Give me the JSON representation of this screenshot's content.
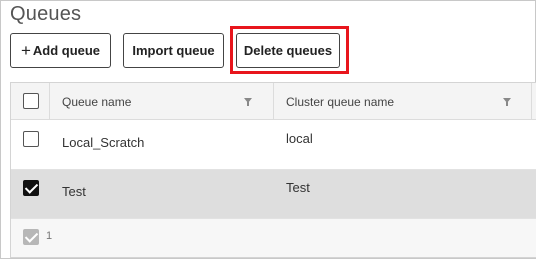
{
  "page": {
    "title": "Queues"
  },
  "toolbar": {
    "add_label": "Add queue",
    "add_icon": "plus-icon",
    "import_label": "Import queue",
    "delete_label": "Delete queues",
    "highlight_color": "#e8151c"
  },
  "grid": {
    "columns": [
      {
        "label": "Queue name",
        "filter_icon": "filter-icon"
      },
      {
        "label": "Cluster queue name",
        "filter_icon": "filter-icon"
      }
    ],
    "rows": [
      {
        "queue_name": "Local_Scratch",
        "cluster_queue_name": "local",
        "selected": false
      },
      {
        "queue_name": "Test",
        "cluster_queue_name": "Test",
        "selected": true
      }
    ],
    "footer": {
      "selected_count": "1"
    },
    "selected_row_color": "#dedede"
  }
}
